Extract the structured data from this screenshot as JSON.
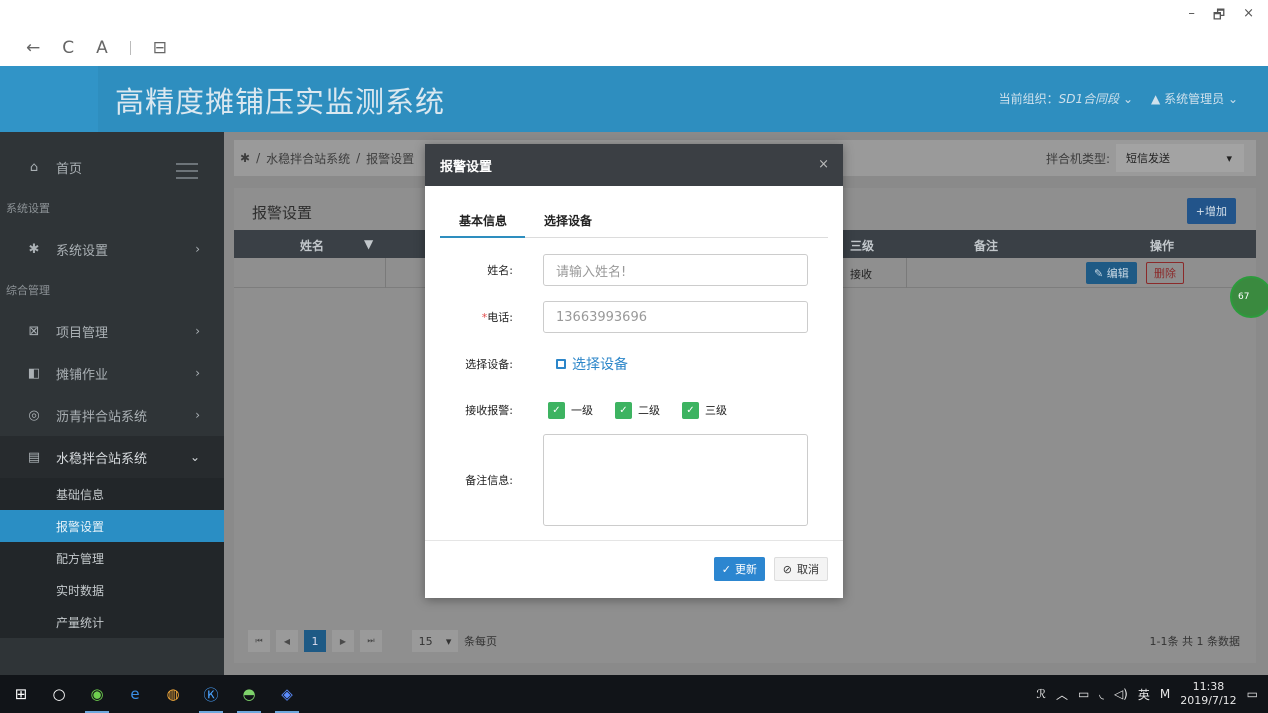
{
  "window": {
    "minimize": "–",
    "restore": "🗗",
    "close": "×"
  },
  "browser": {
    "back": "←",
    "refresh": "C",
    "reader": "A",
    "tabs": "⊟"
  },
  "header": {
    "title": "高精度摊铺压实监测系统",
    "org_label": "当前组织：",
    "org_value": "SD1合同段",
    "org_chevron": "⌄",
    "user_icon": "▲",
    "user": "系统管理员",
    "user_chevron": "⌄"
  },
  "sidebar": {
    "home": "首页",
    "section_settings": "系统设置",
    "settings": "系统设置",
    "section_general": "综合管理",
    "project": "项目管理",
    "paving": "摊铺作业",
    "asphalt": "沥青拌合站系统",
    "stabilized": "水稳拌合站系统",
    "sub": [
      "基础信息",
      "报警设置",
      "配方管理",
      "实时数据",
      "产量统计"
    ]
  },
  "main": {
    "breadcrumb": [
      "水稳拌合站系统",
      "报警设置"
    ],
    "mixer_type_label": "拌合机类型:",
    "mixer_type_value": "短信发送",
    "panel_title": "报警设置",
    "add_button": "+增加",
    "columns": {
      "name": "姓名",
      "level3": "三级",
      "remark": "备注",
      "ops": "操作"
    },
    "row": {
      "level3": "接收",
      "edit": "编辑",
      "delete": "删除"
    },
    "pager": {
      "current": "1",
      "per_page": "15",
      "per_page_suffix": "条每页",
      "total": "1-1条  共 1 条数据"
    },
    "badge": "67"
  },
  "modal": {
    "title": "报警设置",
    "close": "×",
    "tabs": [
      "基本信息",
      "选择设备"
    ],
    "name_label": "姓名:",
    "name_placeholder": "请输入姓名!",
    "phone_req": "*",
    "phone_label": "电话:",
    "phone_value": "13663993696",
    "device_label": "选择设备:",
    "device_link": "选择设备",
    "alarm_label": "接收报警:",
    "levels": [
      "一级",
      "二级",
      "三级"
    ],
    "remark_label": "备注信息:",
    "update_button": "更新",
    "cancel_button": "取消"
  },
  "taskbar": {
    "time": "11:38",
    "date": "2019/7/12",
    "ime": "英",
    "ime2": "M"
  }
}
